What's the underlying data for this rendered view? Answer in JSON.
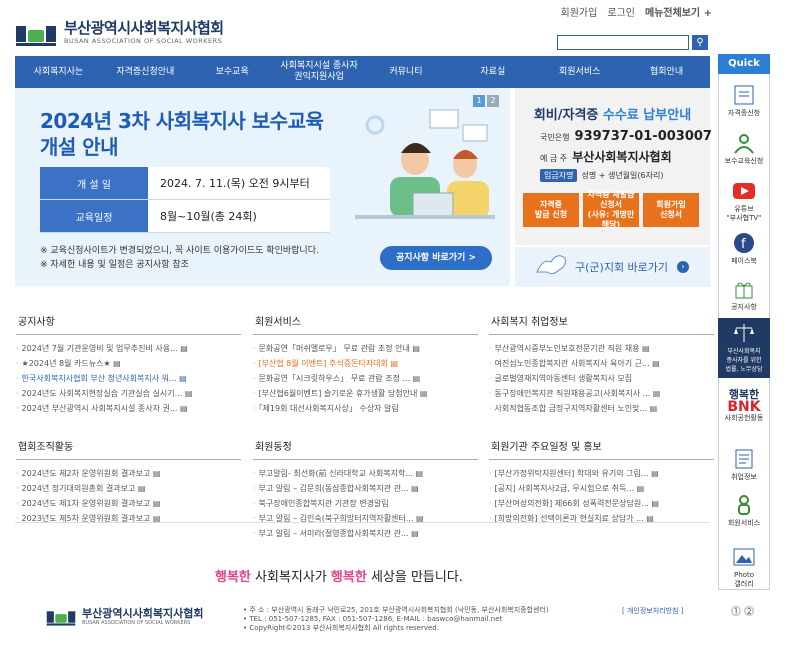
{
  "header": {
    "logo_title": "부산광역시사회복지사협회",
    "logo_subtitle": "BUSAN ASSOCIATION OF SOCIAL WORKERS",
    "top_links": [
      "회원가입",
      "로그인",
      "메뉴전체보기 +"
    ],
    "search_icon": "search-icon"
  },
  "nav": [
    "사회복지사는",
    "자격증신청안내",
    "보수교육",
    "사회복지시설 종사자\n권익지원사업",
    "커뮤니티",
    "자료실",
    "회원서비스",
    "협회안내"
  ],
  "banner": {
    "title": "2024년 3차 사회복지사 보수교육\n개설 안내",
    "pages": [
      "1",
      "2"
    ],
    "rows": [
      {
        "key": "개 설 일",
        "value": "2024. 7. 11.(목) 오전 9시부터"
      },
      {
        "key": "교육일정",
        "value": "8월~10월(총 24회)"
      }
    ],
    "note1": "※ 교육신청사이트가 변경되었으니, 꼭 사이트 이용가이드도 확인바랍니다.",
    "note2": "※ 자세한 내용 및 일정은 공지사항 참조",
    "button": "공지사항 바로가기 >"
  },
  "fee": {
    "title_a": "회비/자격증 ",
    "title_b": "수수료 납부안내",
    "bank_label": "국민은행",
    "bank_account": "939737-01-003007",
    "holder_label": "예 금 주",
    "holder": "부산사회복지사협회",
    "deposit_badge": "입금자명",
    "deposit_text": "성명 + 생년월일(6자리)",
    "buttons": [
      "자격증\n발급 신청",
      "자격증 재발급\n신청서\n(사유: 개명만 해당)",
      "회원가입\n신청서"
    ]
  },
  "branch": {
    "text": "구(군)지회 바로가기",
    "arrow": "›"
  },
  "boards": [
    {
      "title": "공지사항",
      "items": [
        {
          "text": "2024년 7월 기관운영비 및 업무추진비 사용... ▤",
          "cls": ""
        },
        {
          "text": "★2024년 8월 카드뉴스★ ▤",
          "cls": ""
        },
        {
          "text": "한국사회복지사협회 부산 청년사회복지사 워... ▤",
          "cls": "hl"
        },
        {
          "text": "2024년도 사회복지현장실습 기관실습 실시기... ▤",
          "cls": ""
        },
        {
          "text": "2024년 부산광역시 사회복지시설 종사자 권... ▤",
          "cls": ""
        }
      ]
    },
    {
      "title": "회원서비스",
      "items": [
        {
          "text": "문화공연「머쉬멜로우」 무료 관람 조정 안내 ▤",
          "cls": ""
        },
        {
          "text": "[부산협 8월 이벤트] 추석증돈타자대회 ▤",
          "cls": "hl2"
        },
        {
          "text": "문화공연「시크릿하우스」 무료 관람 조정 ... ▤",
          "cls": ""
        },
        {
          "text": "[부산협6월이벤트] 슬기로운 휴가생활 당첨안내 ▤",
          "cls": ""
        },
        {
          "text": "「제19회 대선사회복지사상」 수상자 알림",
          "cls": ""
        }
      ]
    },
    {
      "title": "사회복지 취업정보",
      "items": [
        {
          "text": "부산광역시중부노인보호전문기관 직원 채용 ▤",
          "cls": ""
        },
        {
          "text": "여진섬노인종합복지관 사회복지사 육아기 근... ▤",
          "cls": ""
        },
        {
          "text": "글로벌영재지역아동센터 생활복지사 모집",
          "cls": ""
        },
        {
          "text": "동구장애인복지관 직원채용공고(사회복지사 ... ▤",
          "cls": ""
        },
        {
          "text": "사회적협동조합 금정구지역자활센터 노인맞... ▤",
          "cls": ""
        }
      ]
    },
    {
      "title": "협회조직활동",
      "items": [
        {
          "text": "2024년도 제2차 운영위원회 결과보고 ▤",
          "cls": ""
        },
        {
          "text": "2024년 정기대의원총회 결과보고 ▤",
          "cls": ""
        },
        {
          "text": "2024년도 제1차 운영위원회 결과보고 ▤",
          "cls": ""
        },
        {
          "text": "2023년도 제5차 운영위원회 결과보고 ▤",
          "cls": ""
        }
      ]
    },
    {
      "title": "회원동정",
      "items": [
        {
          "text": "부고알림- 최선화(前 신라대학교 사회복지학... ▤",
          "cls": ""
        },
        {
          "text": "부고 알림 – 김문희(동삼종합사회복지관 관... ▤",
          "cls": ""
        },
        {
          "text": "북구장애인종합복지관 기관장 변경알림",
          "cls": ""
        },
        {
          "text": "부고 알림 – 김인숙(북구희망터지역자활센터... ▤",
          "cls": ""
        },
        {
          "text": "부고 알림 – 서미라(절영종합사회복지관 관... ▤",
          "cls": ""
        }
      ]
    },
    {
      "title": "회원기관 주요일정 및 홍보",
      "items": [
        {
          "text": "[부산가정위탁지원센터] 학대와 유기의 그림... ▤",
          "cls": ""
        },
        {
          "text": "[공지] 사회복지사2급, 무시험으로 취득... ▤",
          "cls": ""
        },
        {
          "text": "[부산여성의전화] 제66회 성폭력전문상담원... ▤",
          "cls": ""
        },
        {
          "text": "[희망의전화] 선택이론과 현실치료 상담가 ... ▤",
          "cls": ""
        }
      ]
    }
  ],
  "quick": {
    "title": "Quick",
    "items": [
      {
        "label": "자격증신청",
        "icon": "certificate-icon"
      },
      {
        "label": "보수교육신청",
        "icon": "education-icon"
      },
      {
        "label": "유튜브\n\"부사협TV\"",
        "icon": "youtube-icon"
      },
      {
        "label": "페이스북",
        "icon": "facebook-icon"
      },
      {
        "label": "공지사항",
        "icon": "gift-icon"
      },
      {
        "label": "부산사회복지\n종사자를 위한\n법률, 노무상담",
        "icon": "scales-icon"
      },
      {
        "label": "사회공헌활동",
        "icon": "bnk-logo"
      },
      {
        "label": "취업정보",
        "icon": "document-icon"
      },
      {
        "label": "회원서비스",
        "icon": "person-icon"
      },
      {
        "label": "Photo\n갤러리",
        "icon": "photo-icon"
      }
    ],
    "bnk_top": "행복한",
    "bnk_main": "BNK"
  },
  "footer": {
    "slogan_a": "행복한",
    "slogan_b": " 사회복지사가 ",
    "slogan_c": "행복한",
    "slogan_d": " 세상을 만듭니다.",
    "logo_title": "부산광역시사회복지사협회",
    "logo_subtitle": "BUSAN ASSOCIATION OF SOCIAL WORKERS",
    "info": "• 주  소 : 부산광역시 동래구 낙민로25, 201호 부산광역시사회복지협회 (낙민동, 부산사회복지종합센터)\n• TEL : 051-507-1285,    FAX : 051-507-1286,    E-MAIL : baswco@hanmail.net\n• CopyRight©2013 부산사회복지사협회 All rights reserved.",
    "privacy": "[ 개인정보처리방침 ]",
    "scroll": "⓵ ⓶"
  },
  "colors": {
    "primary": "#2d63b1",
    "accent": "#e8721c",
    "pink": "#e0468a"
  }
}
